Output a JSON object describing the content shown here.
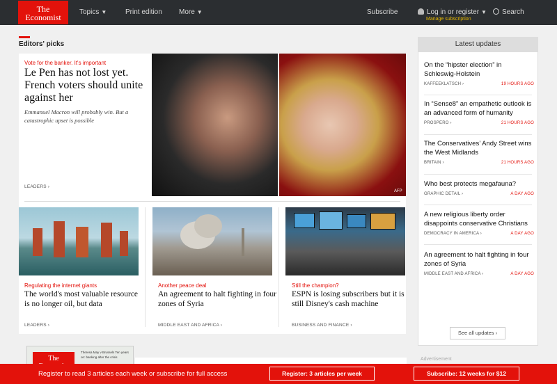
{
  "header": {
    "logo_line1": "The",
    "logo_line2": "Economist",
    "nav": [
      "Topics",
      "Print edition",
      "More"
    ],
    "subscribe": "Subscribe",
    "login": "Log in or register",
    "manage": "Manage subscription",
    "search": "Search"
  },
  "editors_picks": {
    "title": "Editors' picks",
    "lead": {
      "kicker": "Vote for the banker. It's important",
      "headline": "Le Pen has not lost yet. French voters should unite against her",
      "description": "Emmanuel Macron will probably win. But a catastrophic upset is possible",
      "section": "LEADERS",
      "credit": "AFP"
    },
    "cards": [
      {
        "kicker": "Regulating the internet giants",
        "headline": "The world's most valuable resource is no longer oil, but data",
        "section": "LEADERS"
      },
      {
        "kicker": "Another peace deal",
        "headline": "An agreement to halt fighting in four zones of Syria",
        "section": "MIDDLE EAST AND AFRICA"
      },
      {
        "kicker": "Still the champion?",
        "headline": "ESPN is losing subscribers but it is still Disney's cash machine",
        "section": "BUSINESS AND FINANCE"
      }
    ]
  },
  "latest_updates": {
    "title": "Latest updates",
    "items": [
      {
        "title": "On the “hipster election” in Schleswig-Holstein",
        "section": "KAFFEEKLATSCH",
        "time": "19 HOURS AGO"
      },
      {
        "title": "In “Sense8” an empathetic outlook is an advanced form of humanity",
        "section": "PROSPERO",
        "time": "21 HOURS AGO"
      },
      {
        "title": "The Conservatives’ Andy Street wins the West Midlands",
        "section": "BRITAIN",
        "time": "21 HOURS AGO"
      },
      {
        "title": "Who best protects megafauna?",
        "section": "GRAPHIC DETAIL",
        "time": "A DAY AGO"
      },
      {
        "title": "A new religious liberty order disappoints conservative Christians",
        "section": "DEMOCRACY IN AMERICA",
        "time": "A DAY AGO"
      },
      {
        "title": "An agreement to halt fighting in four zones of Syria",
        "section": "MIDDLE EAST AND AFRICA",
        "time": "A DAY AGO"
      }
    ],
    "see_all": "See all updates"
  },
  "bottom": {
    "advertisement": "Advertisement",
    "mag_logo": "The Economist",
    "mag_text": "Theresa May v Brussels Ten years on: banking after the crisis"
  },
  "banner": {
    "text": "Register to read 3 articles each week or subscribe for full access",
    "register_btn": "Register: 3 articles per week",
    "subscribe_btn": "Subscribe: 12 weeks for $12"
  },
  "colors": {
    "brand_red": "#e3120b",
    "nav_bg": "#2b2e31"
  }
}
